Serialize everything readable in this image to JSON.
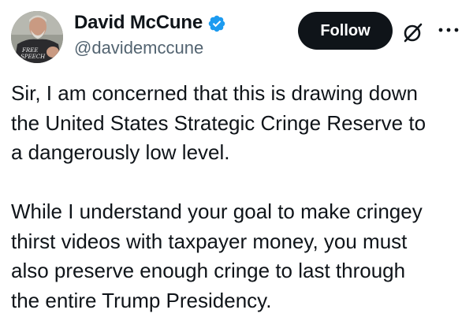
{
  "author": {
    "display_name": "David McCune",
    "handle": "@davidemccune",
    "verified": true,
    "avatar_shirt_text": "FREE SPEECH"
  },
  "actions": {
    "follow_label": "Follow",
    "grok_icon": "grok-slash-icon",
    "more_icon": "more-horizontal-icon"
  },
  "tweet": {
    "paragraphs": [
      "Sir, I am concerned that this is drawing down\nthe United States Strategic Cringe Reserve to\na dangerously low level.",
      "While I understand your goal to make cringey\nthirst videos with taxpayer money, you must\nalso preserve enough cringe to last through\nthe entire Trump Presidency."
    ]
  },
  "colors": {
    "text": "#0f1419",
    "secondary": "#536471",
    "button_bg": "#0f1419",
    "button_text": "#ffffff",
    "verified_blue": "#1d9bf0"
  }
}
